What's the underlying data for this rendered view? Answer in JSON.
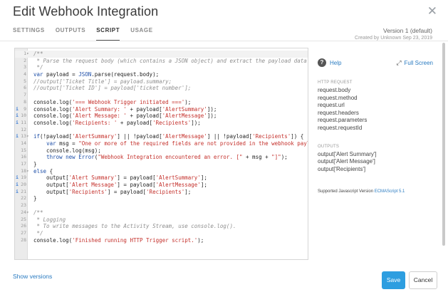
{
  "modal": {
    "title": "Edit Webhook Integration",
    "close_icon": "close-icon"
  },
  "tabs": [
    {
      "label": "SETTINGS",
      "active": false
    },
    {
      "label": "OUTPUTS",
      "active": false
    },
    {
      "label": "SCRIPT",
      "active": true
    },
    {
      "label": "USAGE",
      "active": false
    }
  ],
  "version": {
    "label": "Version 1 (default)",
    "created": "Created by Unknown Sep 23, 2019"
  },
  "editor": {
    "lines": [
      {
        "n": "1",
        "fold": "▾",
        "info": false,
        "html": "<span class='c'>/**</span>"
      },
      {
        "n": "2",
        "fold": "",
        "info": false,
        "html": "<span class='c'> * Parse the request body (which contains a JSON object) and extract the payload data.</span>"
      },
      {
        "n": "3",
        "fold": "",
        "info": false,
        "html": "<span class='c'> */</span>"
      },
      {
        "n": "4",
        "fold": "",
        "info": false,
        "html": "<span class='k'>var</span> payload = <span class='k'>JSON</span>.parse(request.body);"
      },
      {
        "n": "5",
        "fold": "",
        "info": false,
        "html": "<span class='c'>//output['Ticket Title'] = payload.summary;</span>"
      },
      {
        "n": "6",
        "fold": "",
        "info": false,
        "html": "<span class='c'>//output['Ticket ID'] = payload['ticket number'];</span>"
      },
      {
        "n": "7",
        "fold": "",
        "info": false,
        "html": ""
      },
      {
        "n": "8",
        "fold": "",
        "info": false,
        "html": "console.log(<span class='s'>'=== Webhook Trigger initiated ==='</span>);"
      },
      {
        "n": "9",
        "fold": "",
        "info": true,
        "html": "console.log(<span class='s'>'Alert Summary: '</span> + payload[<span class='s'>'AlertSummary'</span>]);"
      },
      {
        "n": "10",
        "fold": "",
        "info": true,
        "html": "console.log(<span class='s'>'Alert Message: '</span> + payload[<span class='s'>'AlertMessage'</span>]);"
      },
      {
        "n": "11",
        "fold": "",
        "info": true,
        "html": "console.log(<span class='s'>'Recipients: '</span> + payload[<span class='s'>'Recipients'</span>]);"
      },
      {
        "n": "12",
        "fold": "",
        "info": false,
        "html": ""
      },
      {
        "n": "13",
        "fold": "▾",
        "info": true,
        "html": "<span class='k'>if</span>(!payload[<span class='s'>'AlertSummary'</span>] || !payload[<span class='s'>'AlertMessage'</span>] || !payload[<span class='s'>'Recipients'</span>]) {"
      },
      {
        "n": "14",
        "fold": "",
        "info": false,
        "html": "    <span class='k'>var</span> msg = <span class='s'>\"One or more of the required fields are not provided in the webhook payload\"</span>"
      },
      {
        "n": "15",
        "fold": "",
        "info": false,
        "html": "    console.log(msg);"
      },
      {
        "n": "16",
        "fold": "",
        "info": false,
        "html": "    <span class='k'>throw new</span> <span class='k'>Error</span>(<span class='s'>\"Webhook Integration encountered an error. [\"</span> + msg + <span class='s'>\"]\"</span>);"
      },
      {
        "n": "17",
        "fold": "",
        "info": false,
        "html": "}"
      },
      {
        "n": "18",
        "fold": "▾",
        "info": false,
        "html": "<span class='k'>else</span> {"
      },
      {
        "n": "19",
        "fold": "",
        "info": true,
        "html": "    output[<span class='s'>'Alert Summary'</span>] = payload[<span class='s'>'AlertSummary'</span>];"
      },
      {
        "n": "20",
        "fold": "",
        "info": true,
        "html": "    output[<span class='s'>'Alert Message'</span>] = payload[<span class='s'>'AlertMessage'</span>];"
      },
      {
        "n": "21",
        "fold": "",
        "info": true,
        "html": "    output[<span class='s'>'Recipients'</span>] = payload[<span class='s'>'Recipients'</span>];"
      },
      {
        "n": "22",
        "fold": "",
        "info": false,
        "html": "}"
      },
      {
        "n": "23",
        "fold": "",
        "info": false,
        "html": ""
      },
      {
        "n": "24",
        "fold": "▾",
        "info": false,
        "html": "<span class='c'>/**</span>"
      },
      {
        "n": "25",
        "fold": "",
        "info": false,
        "html": "<span class='c'> * Logging</span>"
      },
      {
        "n": "26",
        "fold": "",
        "info": false,
        "html": "<span class='c'> * To write messages to the Activity Stream, use console.log().</span>"
      },
      {
        "n": "27",
        "fold": "",
        "info": false,
        "html": "<span class='c'> */</span>"
      },
      {
        "n": "28",
        "fold": "",
        "info": false,
        "html": "console.log(<span class='s'>'Finished running HTTP Trigger script.'</span>);"
      }
    ]
  },
  "sidebar": {
    "help_label": "Help",
    "help_icon": "help-icon",
    "fullscreen_label": "Full Screen",
    "fullscreen_icon": "expand-icon",
    "http_request_heading": "HTTP REQUEST",
    "http_request_items": [
      "request.body",
      "request.method",
      "request.url",
      "request.headers",
      "request.parameters",
      "request.requestId"
    ],
    "outputs_heading": "OUTPUTS",
    "outputs_items": [
      "output['Alert Summary']",
      "output['Alert Message']",
      "output['Recipients']"
    ],
    "supported_label": "Supported Javascript Version",
    "supported_link": "ECMAScript 5.1"
  },
  "footer": {
    "show_versions": "Show versions",
    "save_label": "Save",
    "cancel_label": "Cancel"
  },
  "colors": {
    "accent": "#2d9ee0",
    "link": "#2a7bc1",
    "string": "#c4302b",
    "keyword": "#1e4fa8",
    "comment": "#8f8f8f"
  }
}
